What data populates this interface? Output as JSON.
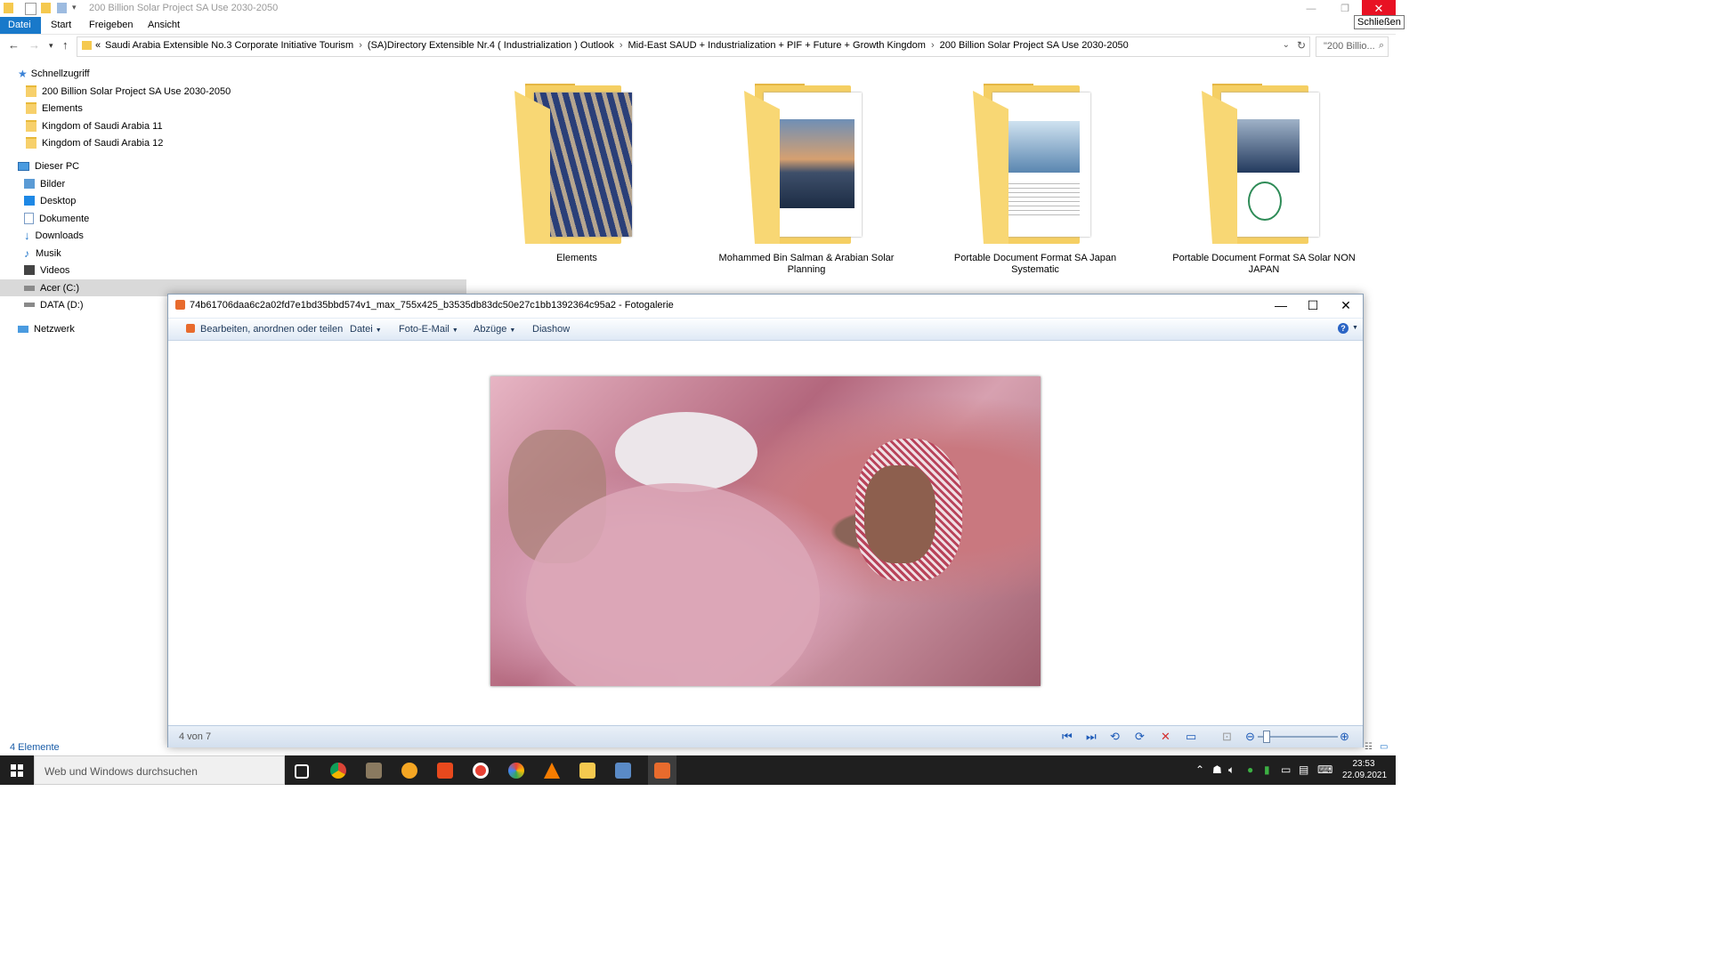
{
  "explorer": {
    "title": "200 Billion Solar Project SA Use 2030-2050",
    "close_tooltip": "Schließen",
    "ribbon_tabs": [
      "Datei",
      "Start",
      "Freigeben",
      "Ansicht"
    ],
    "address_prefix": "«",
    "breadcrumbs": [
      "Saudi Arabia Extensible No.3 Corporate Initiative Tourism",
      "(SA)Directory Extensible Nr.4 ( Industrialization )  Outlook",
      "Mid-East SAUD + Industrialization + PIF + Future + Growth Kingdom",
      "200 Billion Solar Project SA Use 2030-2050"
    ],
    "search_placeholder": "\"200 Billio...",
    "nav": {
      "quick_access": "Schnellzugriff",
      "quick_items": [
        "200 Billion Solar Project SA Use 2030-2050",
        "Elements",
        "Kingdom of Saudi Arabia 11",
        "Kingdom of Saudi Arabia 12"
      ],
      "this_pc": "Dieser PC",
      "pc_items": [
        "Bilder",
        "Desktop",
        "Dokumente",
        "Downloads",
        "Musik",
        "Videos",
        "Acer (C:)",
        "DATA (D:)"
      ],
      "network": "Netzwerk"
    },
    "folders": [
      "Elements",
      "Mohammed Bin Salman & Arabian Solar Planning",
      "Portable Document Format SA Japan Systematic",
      "Portable Document Format SA Solar NON JAPAN"
    ],
    "status": "4 Elemente"
  },
  "gallery": {
    "title": "74b61706daa6c2a02fd7e1bd35bbd574v1_max_755x425_b3535db83dc50e27c1bb1392364c95a2 - Fotogalerie",
    "menu": {
      "edit": "Bearbeiten, anordnen oder teilen",
      "file": "Datei",
      "email": "Foto-E-Mail",
      "prints": "Abzüge",
      "slideshow": "Diashow"
    },
    "counter": "4 von 7"
  },
  "taskbar": {
    "search_placeholder": "Web und Windows durchsuchen",
    "time": "23:53",
    "date": "22.09.2021"
  },
  "colors": {
    "accent": "#1979ca",
    "close_red": "#e81123",
    "folder_yellow": "#f5cf63",
    "taskbar": "#1f1f1f"
  }
}
